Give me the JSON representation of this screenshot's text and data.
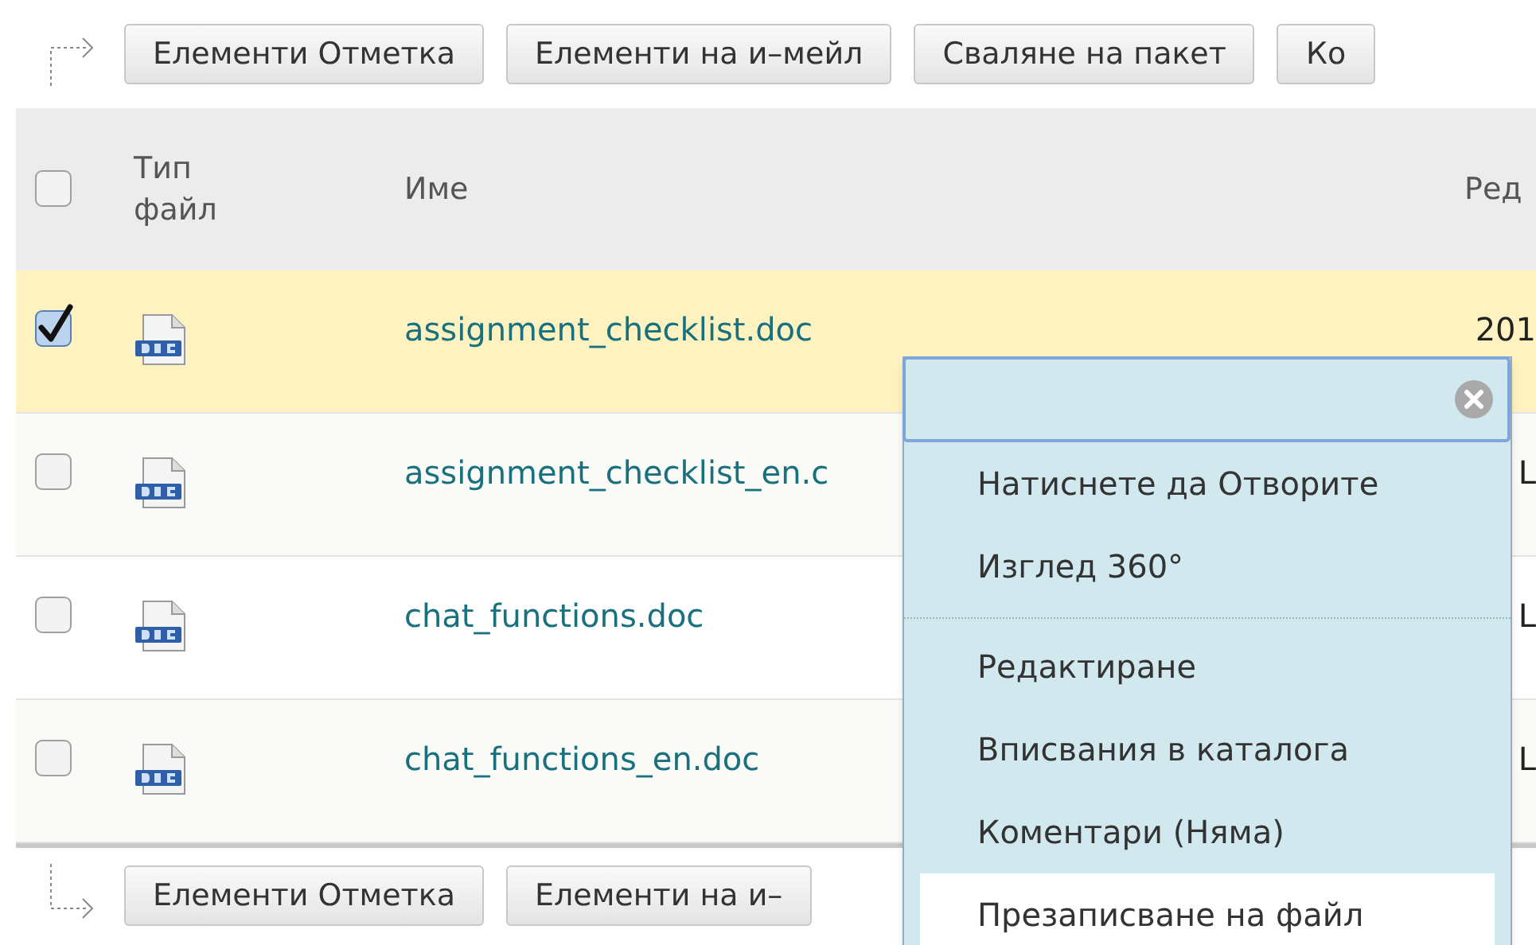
{
  "top_toolbar": {
    "buttons": [
      "Елементи Отметка",
      "Елементи на и–мейл",
      "Сваляне на пакет",
      "Ко"
    ]
  },
  "table": {
    "header": {
      "checked": false,
      "columns": [
        "Тип файл",
        "Име",
        "Ред"
      ]
    },
    "rows": [
      {
        "checked": true,
        "selected": true,
        "name": "assignment_checklist.doc",
        "column_3": "201"
      },
      {
        "checked": false,
        "selected": false,
        "name": "assignment_checklist_en.c",
        "column_3": "L"
      },
      {
        "checked": false,
        "selected": false,
        "name": "chat_functions.doc",
        "column_3": "L"
      },
      {
        "checked": false,
        "selected": false,
        "name": "chat_functions_en.doc",
        "column_3": "L"
      }
    ]
  },
  "bottom_toolbar": {
    "buttons": [
      "Елементи Отметка",
      "Елементи на и–"
    ]
  },
  "context_menu": {
    "groups": [
      [
        {
          "label": "Натиснете да Отворите",
          "selected": false
        },
        {
          "label": "Изглед 360°",
          "selected": false
        }
      ],
      [
        {
          "label": "Редактиране",
          "selected": false
        },
        {
          "label": "Вписвания в каталога",
          "selected": false
        },
        {
          "label": "Коментари (Няма)",
          "selected": false
        },
        {
          "label": "Презаписване на файл",
          "selected": true
        }
      ]
    ]
  }
}
